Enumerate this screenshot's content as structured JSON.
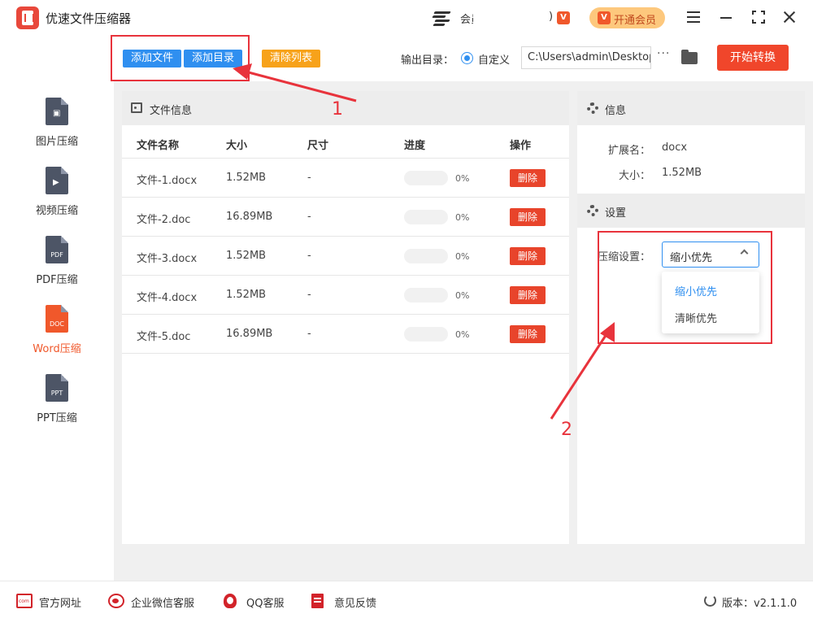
{
  "app": {
    "title": "优速文件压缩器",
    "member_text": "会员",
    "vip_glyph": ")",
    "vip_icon_letter": "V",
    "vip_button": "开通会员"
  },
  "sidebar": {
    "items": [
      {
        "label": "图片压缩",
        "tag": "",
        "icon": "image-file-icon",
        "active": false
      },
      {
        "label": "视频压缩",
        "tag": "",
        "icon": "video-file-icon",
        "active": false
      },
      {
        "label": "PDF压缩",
        "tag": "PDF",
        "icon": "pdf-file-icon",
        "active": false
      },
      {
        "label": "Word压缩",
        "tag": "DOC",
        "icon": "doc-file-icon",
        "active": true
      },
      {
        "label": "PPT压缩",
        "tag": "PPT",
        "icon": "ppt-file-icon",
        "active": false
      }
    ]
  },
  "toolbar": {
    "add_file": "添加文件",
    "add_folder": "添加目录",
    "clear_list": "清除列表",
    "output_label": "输出目录：",
    "output_option": "自定义",
    "output_path": "C:\\Users\\admin\\Desktop",
    "more": "···",
    "start": "开始转换"
  },
  "file_panel": {
    "title": "文件信息",
    "columns": [
      "文件名称",
      "大小",
      "尺寸",
      "进度",
      "操作"
    ],
    "rows": [
      {
        "name": "文件-1.docx",
        "size": "1.52MB",
        "dimension": "-",
        "progress": 0,
        "progress_label": "0%",
        "action": "删除"
      },
      {
        "name": "文件-2.doc",
        "size": "16.89MB",
        "dimension": "-",
        "progress": 0,
        "progress_label": "0%",
        "action": "删除"
      },
      {
        "name": "文件-3.docx",
        "size": "1.52MB",
        "dimension": "-",
        "progress": 0,
        "progress_label": "0%",
        "action": "删除"
      },
      {
        "name": "文件-4.docx",
        "size": "1.52MB",
        "dimension": "-",
        "progress": 0,
        "progress_label": "0%",
        "action": "删除"
      },
      {
        "name": "文件-5.doc",
        "size": "16.89MB",
        "dimension": "-",
        "progress": 0,
        "progress_label": "0%",
        "action": "删除"
      }
    ]
  },
  "info_panel": {
    "title": "信息",
    "ext_label": "扩展名：",
    "ext_value": "docx",
    "size_label": "大小：",
    "size_value": "1.52MB"
  },
  "settings": {
    "title": "设置",
    "compress_label": "压缩设置：",
    "selected": "缩小优先",
    "options": [
      "缩小优先",
      "清晰优先"
    ]
  },
  "annotations": {
    "one": "1",
    "two": "2",
    "color": "#e8333c"
  },
  "footer": {
    "website": "官方网址",
    "wechat": "企业微信客服",
    "qq": "QQ客服",
    "feedback": "意见反馈",
    "version": "版本：v2.1.1.0"
  },
  "colors": {
    "accent_blue": "#2f8ff0",
    "accent_orange": "#f7a21a",
    "danger": "#e8442b",
    "active_sidebar": "#f0582b"
  }
}
